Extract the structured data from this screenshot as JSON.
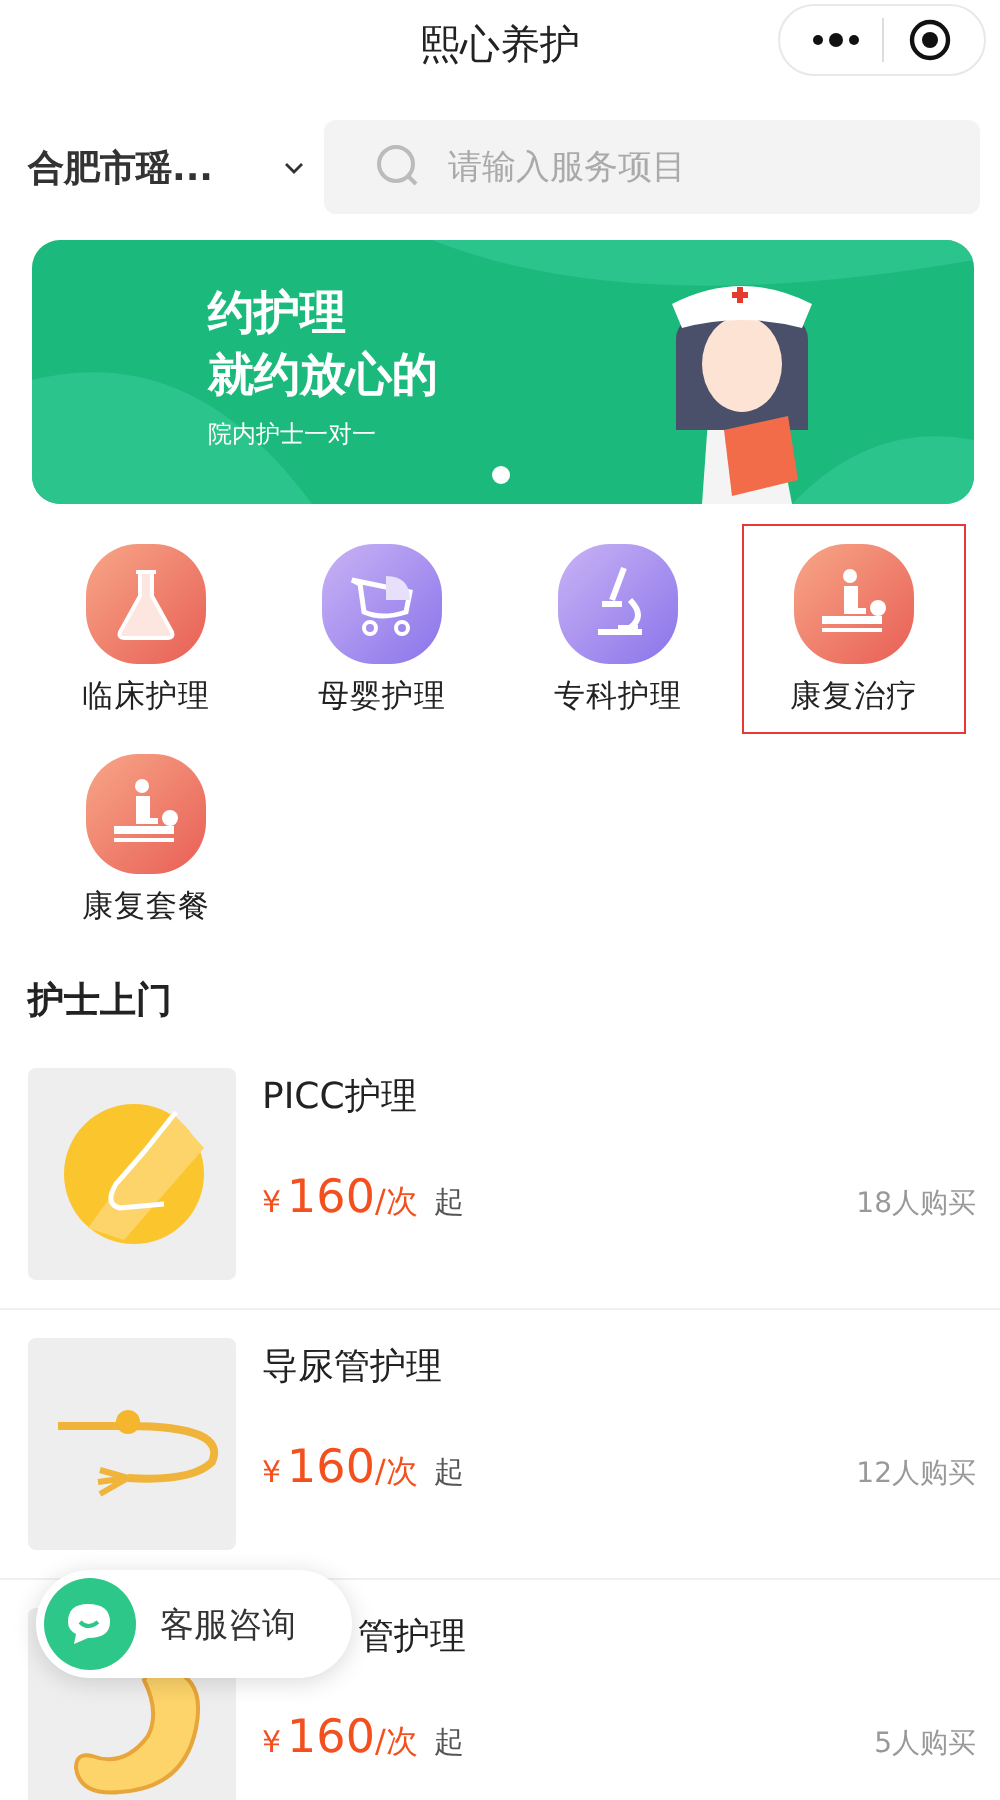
{
  "window": {
    "title": "熙心养护"
  },
  "location": {
    "label": "合肥市瑶..."
  },
  "search": {
    "placeholder": "请输入服务项目"
  },
  "banner": {
    "headline": [
      "约护理",
      "就约放心的"
    ],
    "subtitle": "院内护士一对一",
    "pages": [
      {
        "selected": true
      }
    ]
  },
  "categories": [
    {
      "label": "临床护理",
      "kind": "flask",
      "selected": false
    },
    {
      "label": "母婴护理",
      "kind": "stroller",
      "selected": false
    },
    {
      "label": "专科护理",
      "kind": "microscope",
      "selected": false
    },
    {
      "label": "康复治疗",
      "kind": "massage",
      "selected": true
    },
    {
      "label": "康复套餐",
      "kind": "massage",
      "selected": false
    }
  ],
  "section_title": "护士上门",
  "services": [
    {
      "title": "PICC护理",
      "kind": "picc",
      "currency": "¥",
      "price": "160",
      "unit": "/次",
      "suffix": "起",
      "sold": "18人购买"
    },
    {
      "title": "导尿管护理",
      "kind": "catheter",
      "currency": "¥",
      "price": "160",
      "unit": "/次",
      "suffix": "起",
      "sold": "12人购买"
    },
    {
      "title": "管护理",
      "title_covered": true,
      "kind": "stomach",
      "currency": "¥",
      "price": "160",
      "unit": "/次",
      "suffix": "起",
      "sold": "5人购买"
    }
  ],
  "chat_button": {
    "label": "客服咨询"
  }
}
